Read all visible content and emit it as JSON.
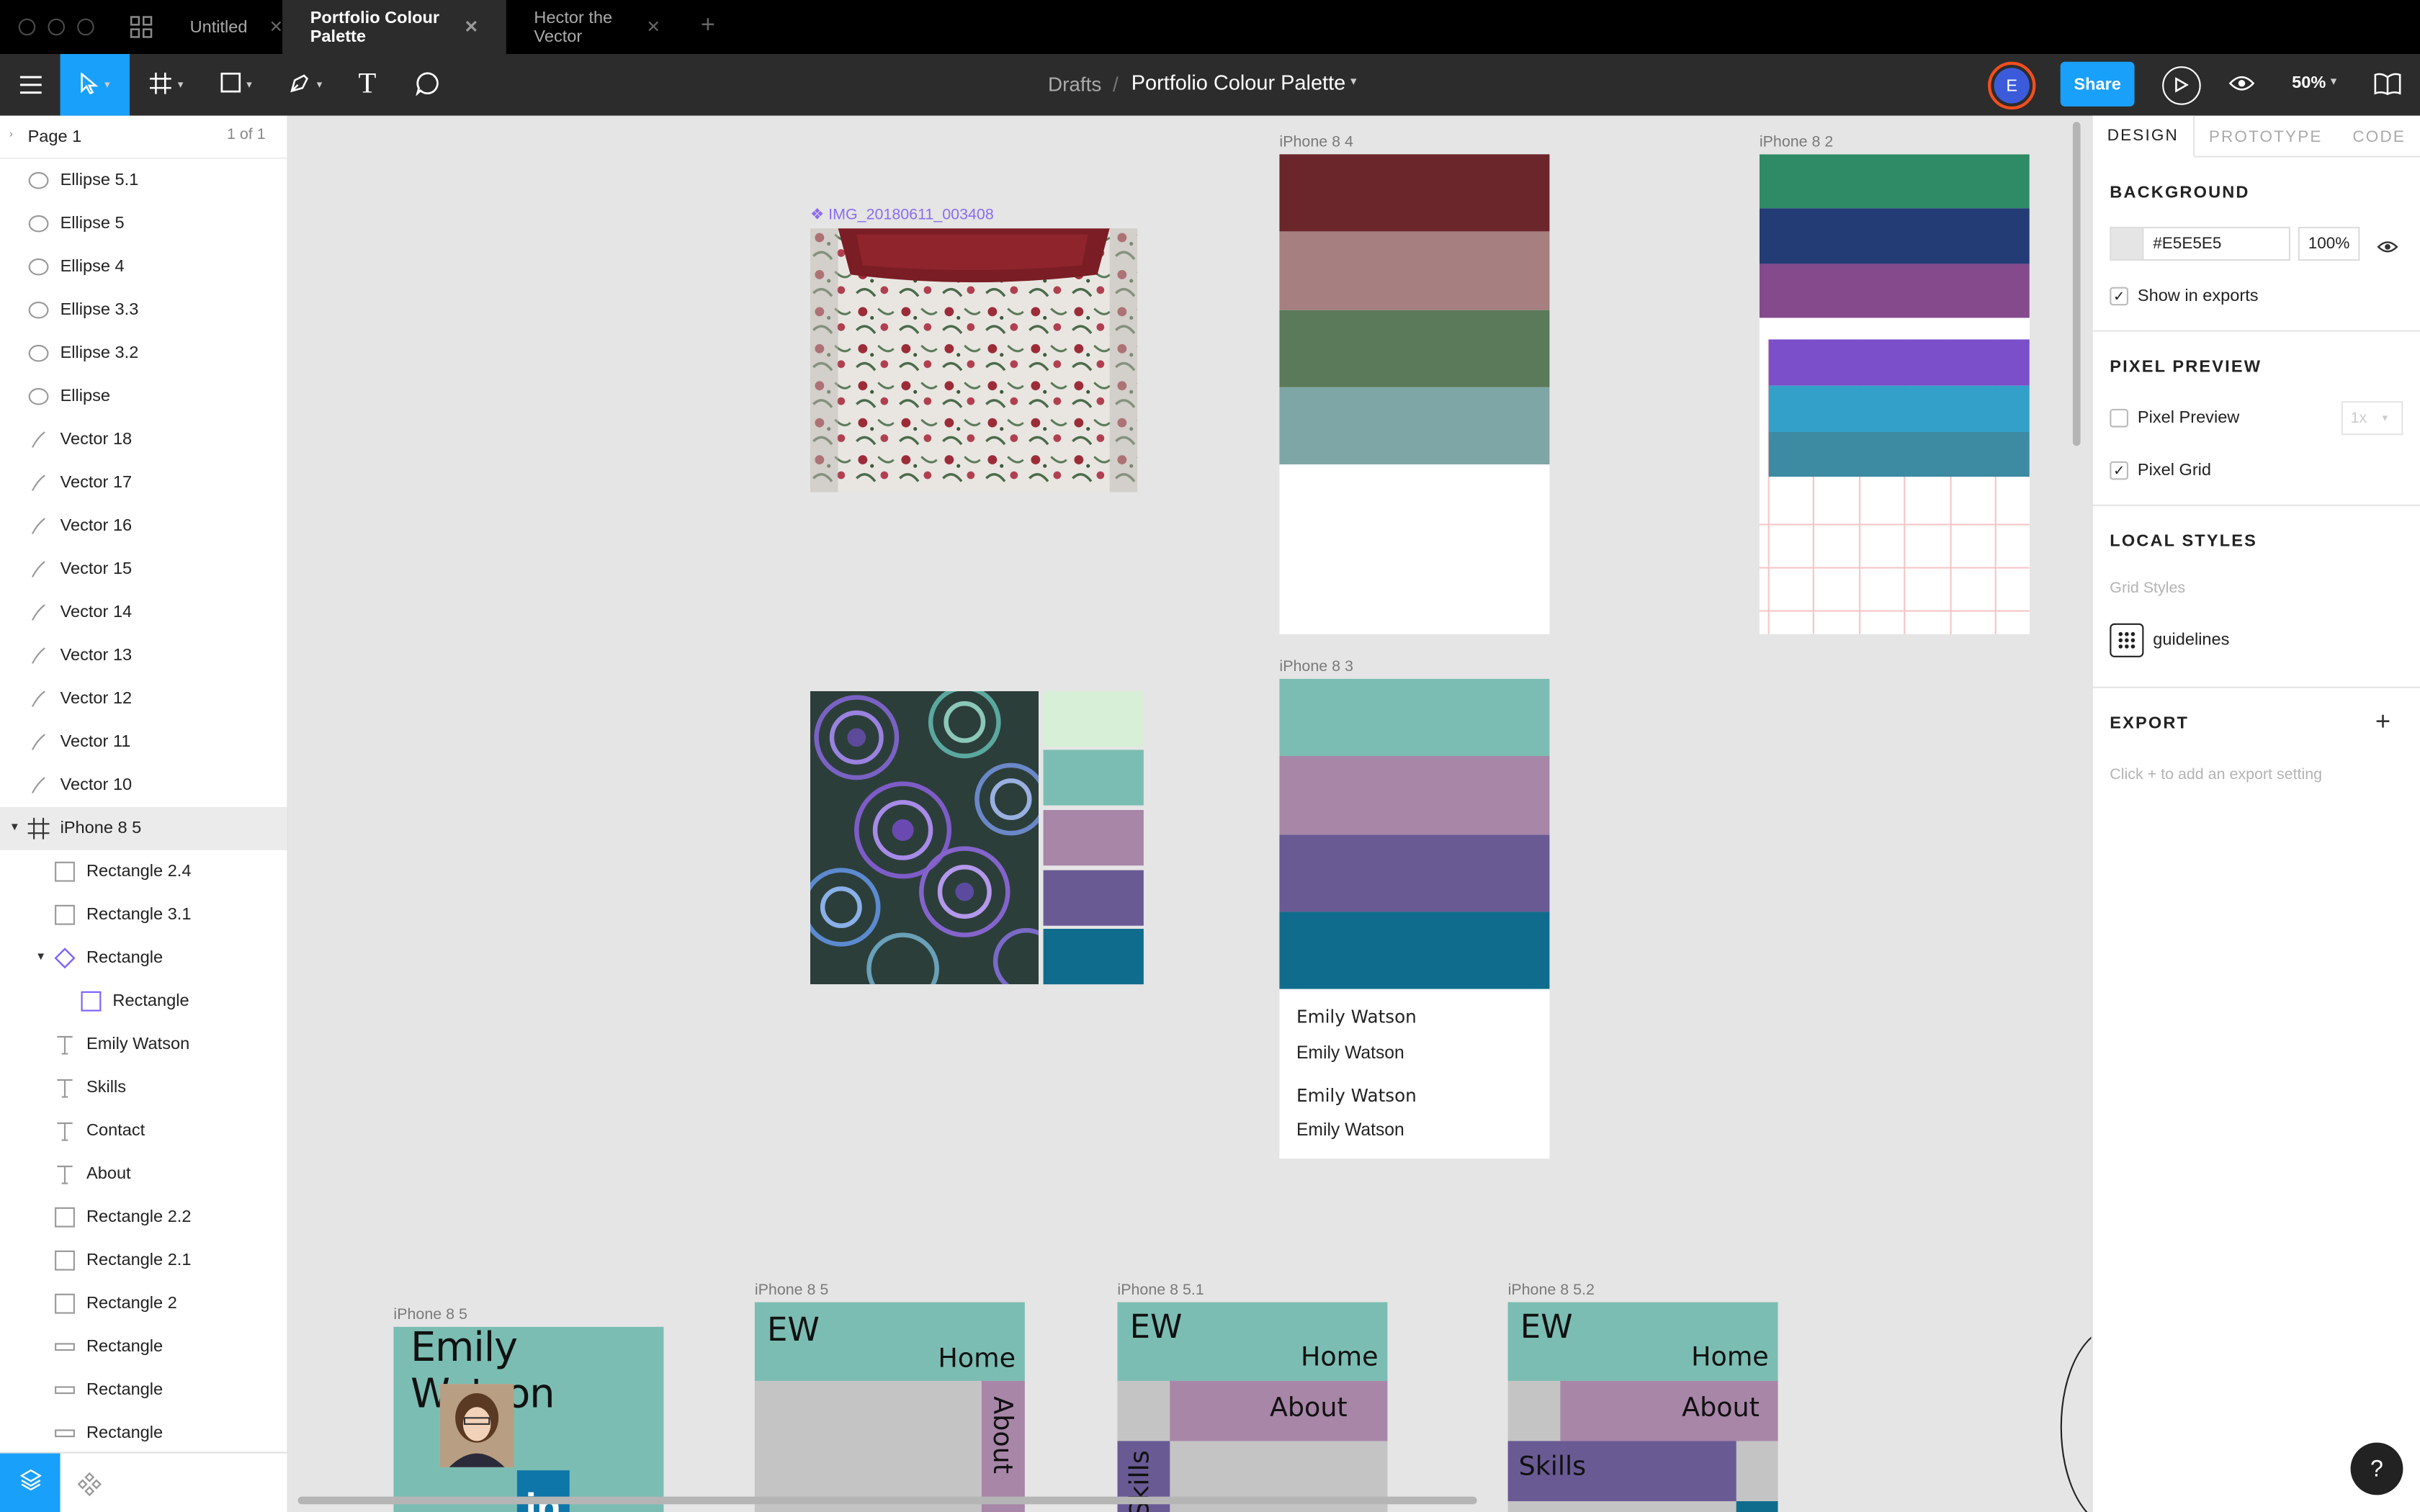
{
  "tabs": [
    {
      "label": "Untitled"
    },
    {
      "label": "Portfolio Colour Palette"
    },
    {
      "label": "Hector the Vector"
    }
  ],
  "header": {
    "breadcrumb_root": "Drafts",
    "breadcrumb_sep": "/",
    "file_title": "Portfolio Colour Palette",
    "avatar_initial": "E",
    "share_label": "Share",
    "zoom": "50%"
  },
  "left_panel": {
    "page_name": "Page 1",
    "page_count": "1 of 1",
    "layers": [
      {
        "label": "Ellipse 5.1",
        "icon": "ellipse-icon"
      },
      {
        "label": "Ellipse 5",
        "icon": "ellipse-icon"
      },
      {
        "label": "Ellipse 4",
        "icon": "ellipse-icon"
      },
      {
        "label": "Ellipse 3.3",
        "icon": "ellipse-icon"
      },
      {
        "label": "Ellipse 3.2",
        "icon": "ellipse-icon"
      },
      {
        "label": "Ellipse",
        "icon": "ellipse-icon"
      },
      {
        "label": "Vector 18",
        "icon": "vector-icon"
      },
      {
        "label": "Vector 17",
        "icon": "vector-icon"
      },
      {
        "label": "Vector 16",
        "icon": "vector-icon"
      },
      {
        "label": "Vector 15",
        "icon": "vector-icon"
      },
      {
        "label": "Vector 14",
        "icon": "vector-icon"
      },
      {
        "label": "Vector 13",
        "icon": "vector-icon"
      },
      {
        "label": "Vector 12",
        "icon": "vector-icon"
      },
      {
        "label": "Vector 11",
        "icon": "vector-icon"
      },
      {
        "label": "Vector 10",
        "icon": "vector-icon"
      },
      {
        "label": "iPhone 8 5",
        "icon": "frame-icon"
      },
      {
        "label": "Rectangle 2.4",
        "icon": "rectangle-icon"
      },
      {
        "label": "Rectangle 3.1",
        "icon": "rectangle-icon"
      },
      {
        "label": "Rectangle",
        "icon": "component-icon"
      },
      {
        "label": "Rectangle",
        "icon": "instance-icon"
      },
      {
        "label": "Emily Watson",
        "icon": "text-icon"
      },
      {
        "label": "Skills",
        "icon": "text-icon"
      },
      {
        "label": "Contact",
        "icon": "text-icon"
      },
      {
        "label": "About",
        "icon": "text-icon"
      },
      {
        "label": "Rectangle 2.2",
        "icon": "rectangle-icon"
      },
      {
        "label": "Rectangle 2.1",
        "icon": "rectangle-icon"
      },
      {
        "label": "Rectangle 2",
        "icon": "rectangle-icon"
      },
      {
        "label": "Rectangle",
        "icon": "line-icon"
      },
      {
        "label": "Rectangle",
        "icon": "line-icon"
      },
      {
        "label": "Rectangle",
        "icon": "line-icon"
      }
    ]
  },
  "right_panel": {
    "tabs": [
      "DESIGN",
      "PROTOTYPE",
      "CODE"
    ],
    "background_title": "BACKGROUND",
    "background_hex": "#E5E5E5",
    "background_opacity": "100%",
    "show_in_exports": "Show in exports",
    "pixel_preview_title": "PIXEL PREVIEW",
    "pixel_preview_label": "Pixel Preview",
    "pixel_preview_scale": "1x",
    "pixel_grid_label": "Pixel Grid",
    "local_styles_title": "LOCAL STYLES",
    "grid_styles_label": "Grid Styles",
    "guidelines_label": "guidelines",
    "export_title": "EXPORT",
    "export_hint": "Click + to add an export setting"
  },
  "canvas": {
    "image_label": "IMG_20180611_003408",
    "frames": {
      "iphone84": "iPhone 8 4",
      "iphone82": "iPhone 8 2",
      "iphone83": "iPhone 8 3",
      "iphone85a": "iPhone 8 5",
      "iphone85b": "iPhone 8 5",
      "iphone851": "iPhone 8 5.1",
      "iphone852": "iPhone 8 5.2"
    },
    "palette_84": [
      "#6b262b",
      "#a67f80",
      "#5a7a5a",
      "#7fa6a6"
    ],
    "palette_82": [
      "#2e8b66",
      "#243c75",
      "#844a8c",
      "#7b4fc9",
      "#33a0c9",
      "#3d8aa3"
    ],
    "palette_83": [
      "#7bbdb3",
      "#a886a8",
      "#6a5a94",
      "#106c8c"
    ],
    "swatches_succulent": [
      "#d6efd6",
      "#7bbdb3",
      "#a886a8",
      "#6a5a94",
      "#106c8c"
    ],
    "name_samples": [
      "Emily Watson",
      "Emily Watson",
      "Emily Watson",
      "Emily Watson"
    ],
    "mock_a": {
      "name": "Emily Watson",
      "linkedin": "in"
    },
    "mock_b": {
      "logo": "EW",
      "home": "Home",
      "about": "About"
    },
    "mock_c": {
      "logo": "EW",
      "home": "Home",
      "about": "About",
      "skills": "Skills"
    },
    "mock_d": {
      "logo": "EW",
      "home": "Home",
      "about": "About",
      "skills": "Skills"
    }
  },
  "help_label": "?"
}
